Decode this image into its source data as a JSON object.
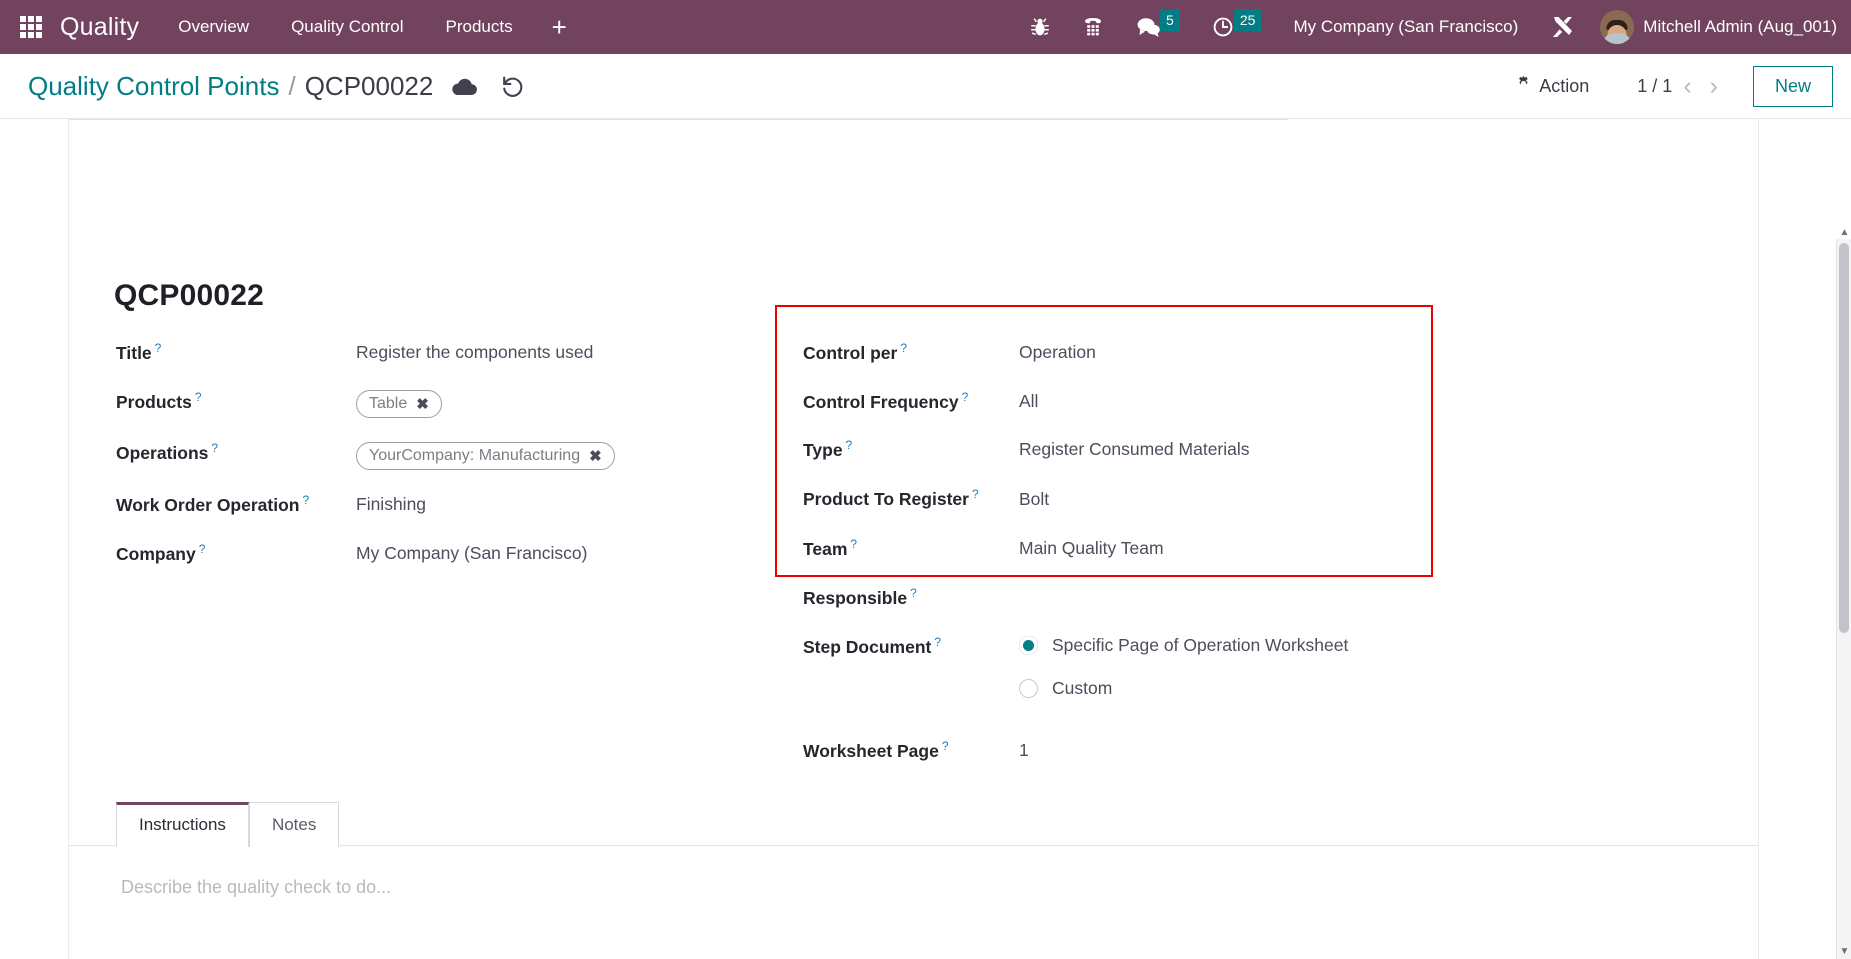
{
  "navbar": {
    "apps_icon": "apps-grid-icon",
    "brand": "Quality",
    "menu": [
      {
        "label": "Overview"
      },
      {
        "label": "Quality Control"
      },
      {
        "label": "Products"
      }
    ],
    "plus_label": "+",
    "systray": [
      {
        "name": "bug-icon",
        "badge": ""
      },
      {
        "name": "phone-dialpad-icon",
        "badge": ""
      },
      {
        "name": "chat-icon",
        "badge": "5"
      },
      {
        "name": "clock-activity-icon",
        "badge": "25"
      }
    ],
    "company": "My Company (San Francisco)",
    "tools_icon": "tools-wrench-icon",
    "user": "Mitchell Admin (Aug_001)",
    "accent_purple": "#71435f",
    "badge_color": "#017e84"
  },
  "control_panel": {
    "breadcrumb_parent": "Quality Control Points",
    "breadcrumb_separator": "/",
    "breadcrumb_current": "QCP00022",
    "save_icon": "cloud-upload-icon",
    "discard_icon": "undo-rotate-icon",
    "action_label": "Action",
    "action_icon": "gear-icon",
    "pager": "1 / 1",
    "prev_icon": "chevron-left-icon",
    "next_icon": "chevron-right-icon",
    "new_label": "New",
    "accent_teal": "#017e84"
  },
  "form": {
    "record_title": "QCP00022",
    "left_fields": [
      {
        "label": "Title",
        "value": "Register the components used",
        "type": "text"
      },
      {
        "label": "Products",
        "value": "Table",
        "type": "chip"
      },
      {
        "label": "Operations",
        "value": "YourCompany: Manufacturing",
        "type": "chip"
      },
      {
        "label": "Work Order Operation",
        "value": "Finishing",
        "type": "text"
      },
      {
        "label": "Company",
        "value": "My Company (San Francisco)",
        "type": "text"
      }
    ],
    "right_fields": [
      {
        "label": "Control per",
        "value": "Operation"
      },
      {
        "label": "Control Frequency",
        "value": "All"
      },
      {
        "label": "Type",
        "value": "Register Consumed Materials"
      },
      {
        "label": "Product To Register",
        "value": "Bolt"
      },
      {
        "label": "Team",
        "value": "Main Quality Team"
      },
      {
        "label": "Responsible",
        "value": ""
      }
    ],
    "step_document": {
      "label": "Step Document",
      "options": [
        {
          "label": "Specific Page of Operation Worksheet",
          "selected": true
        },
        {
          "label": "Custom",
          "selected": false
        }
      ]
    },
    "worksheet_page": {
      "label": "Worksheet Page",
      "value": "1"
    },
    "help_marker": "?",
    "chip_remove_icon": "remove-x-icon",
    "highlight_color": "#ee0000"
  },
  "tabs": {
    "items": [
      {
        "label": "Instructions",
        "active": true
      },
      {
        "label": "Notes",
        "active": false
      }
    ],
    "placeholder": "Describe the quality check to do..."
  }
}
